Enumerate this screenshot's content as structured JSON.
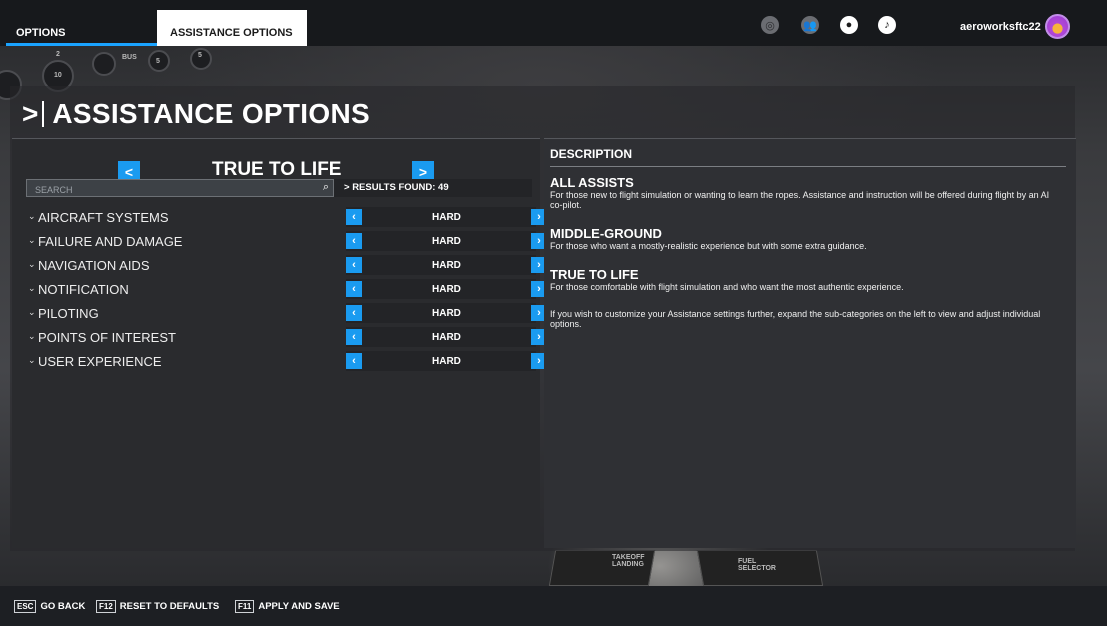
{
  "tabs": {
    "options": "OPTIONS",
    "assistance": "ASSISTANCE OPTIONS"
  },
  "user": {
    "name": "aeroworksftc22"
  },
  "top_icons": [
    "radar-icon",
    "friends-icon",
    "profile-icon",
    "notification-icon"
  ],
  "page_title": "ASSISTANCE OPTIONS",
  "preset": {
    "label": "TRUE TO LIFE",
    "prev": "<",
    "next": ">"
  },
  "search": {
    "placeholder": "SEARCH"
  },
  "results": "RESULTS FOUND: 49",
  "categories": [
    {
      "label": "AIRCRAFT SYSTEMS",
      "value": "HARD"
    },
    {
      "label": "FAILURE AND DAMAGE",
      "value": "HARD"
    },
    {
      "label": "NAVIGATION AIDS",
      "value": "HARD"
    },
    {
      "label": "NOTIFICATION",
      "value": "HARD"
    },
    {
      "label": "PILOTING",
      "value": "HARD"
    },
    {
      "label": "POINTS OF INTEREST",
      "value": "HARD"
    },
    {
      "label": "USER EXPERIENCE",
      "value": "HARD"
    }
  ],
  "description": {
    "heading": "DESCRIPTION",
    "items": [
      {
        "title": "ALL ASSISTS",
        "text": "For those new to flight simulation or wanting to learn the ropes. Assistance and instruction will be offered during flight by an AI co-pilot."
      },
      {
        "title": "MIDDLE-GROUND",
        "text": "For those who want a mostly-realistic experience but with some extra guidance."
      },
      {
        "title": "TRUE TO LIFE",
        "text": "For those comfortable with flight simulation and who want the most authentic experience."
      }
    ],
    "footer": "If you wish to customize your Assistance settings further, expand the sub-categories on the left to view and adjust individual options."
  },
  "bottom": {
    "back_key": "ESC",
    "back": "GO BACK",
    "reset_key": "F12",
    "reset": "RESET TO DEFAULTS",
    "apply_key": "F11",
    "apply": "APPLY AND SAVE"
  },
  "cockpit_labels": [
    "BUS",
    "10",
    "5",
    "5",
    "2",
    "TAKEOFF LANDING",
    "FUEL SELECTOR"
  ],
  "colors": {
    "accent": "#1a9bf0",
    "panel": "#2a2b2e",
    "tab_active": "#ffffff"
  }
}
